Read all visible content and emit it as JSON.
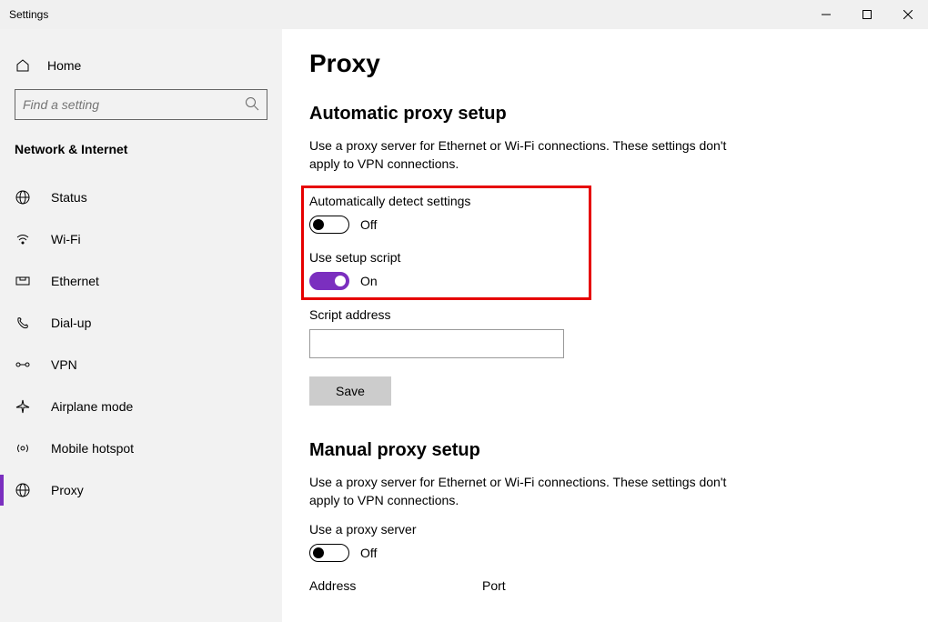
{
  "window": {
    "title": "Settings"
  },
  "sidebar": {
    "home_label": "Home",
    "search_placeholder": "Find a setting",
    "section_label": "Network & Internet",
    "items": [
      {
        "label": "Status"
      },
      {
        "label": "Wi-Fi"
      },
      {
        "label": "Ethernet"
      },
      {
        "label": "Dial-up"
      },
      {
        "label": "VPN"
      },
      {
        "label": "Airplane mode"
      },
      {
        "label": "Mobile hotspot"
      },
      {
        "label": "Proxy"
      }
    ]
  },
  "page": {
    "title": "Proxy",
    "auto_section": {
      "title": "Automatic proxy setup",
      "description": "Use a proxy server for Ethernet or Wi-Fi connections. These settings don't apply to VPN connections.",
      "auto_detect_label": "Automatically detect settings",
      "auto_detect_state": "Off",
      "use_script_label": "Use setup script",
      "use_script_state": "On",
      "script_address_label": "Script address",
      "script_address_value": "",
      "save_label": "Save"
    },
    "manual_section": {
      "title": "Manual proxy setup",
      "description": "Use a proxy server for Ethernet or Wi-Fi connections. These settings don't apply to VPN connections.",
      "use_proxy_label": "Use a proxy server",
      "use_proxy_state": "Off",
      "address_label": "Address",
      "port_label": "Port"
    }
  }
}
